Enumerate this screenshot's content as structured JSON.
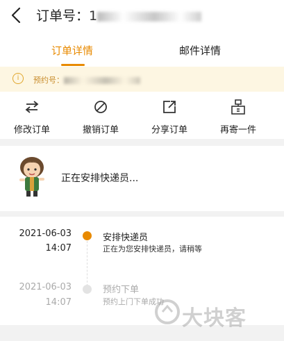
{
  "header": {
    "order_label": "订单号：",
    "order_number_visible": "1"
  },
  "tabs": [
    {
      "label": "订单详情"
    },
    {
      "label": "邮件详情"
    }
  ],
  "notice": {
    "prefix": "预约号："
  },
  "actions": [
    {
      "label": "修改订单",
      "icon": "swap-icon"
    },
    {
      "label": "撤销订单",
      "icon": "cancel-icon"
    },
    {
      "label": "分享订单",
      "icon": "share-icon"
    },
    {
      "label": "再寄一件",
      "icon": "package-icon"
    }
  ],
  "status": {
    "text": "正在安排快递员..."
  },
  "timeline": [
    {
      "date": "2021-06-03",
      "time": "14:07",
      "title": "安排快递员",
      "desc": "正在为您安排快递员，请稍等",
      "active": true
    },
    {
      "date": "2021-06-03",
      "time": "14:07",
      "title": "预约下单",
      "desc": "预约上门下单成功",
      "active": false
    }
  ],
  "colors": {
    "accent": "#e88a00",
    "notice_bg": "#fdf6e2",
    "inactive": "#aaaaaa"
  },
  "watermark": {
    "brand": "大块客"
  }
}
